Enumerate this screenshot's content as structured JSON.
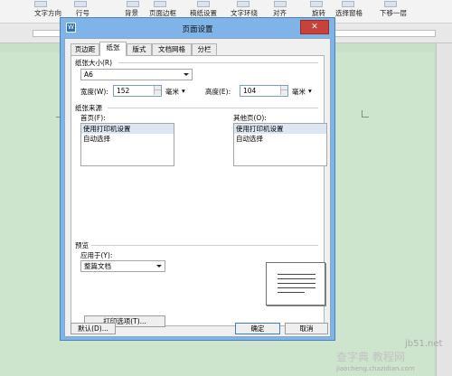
{
  "toolbar": {
    "items": [
      "文字方向",
      "行号",
      "背景",
      "页面边框",
      "稿纸设置",
      "文字环绕",
      "对齐",
      "旋转",
      "选择窗格",
      "下移一层"
    ]
  },
  "dialog": {
    "title": "页面设置",
    "app_icon": "W",
    "close_glyph": "✕",
    "tabs": [
      "页边距",
      "纸张",
      "版式",
      "文档网格",
      "分栏"
    ],
    "active_tab": "纸张",
    "paper_size_label": "纸张大小(R)",
    "paper_size_value": "A6",
    "width_label": "宽度(W):",
    "width_value": "152",
    "width_unit": "毫米",
    "height_label": "高度(E):",
    "height_value": "104",
    "height_unit": "毫米",
    "source_label": "纸张来源",
    "first_page_label": "首页(F):",
    "first_page_options": [
      "使用打印机设置",
      "自动选择"
    ],
    "other_pages_label": "其他页(O):",
    "other_pages_options": [
      "使用打印机设置",
      "自动选择"
    ],
    "preview_label": "预览",
    "apply_to_label": "应用于(Y):",
    "apply_to_value": "整篇文档",
    "print_options_button": "打印选项(T)...",
    "default_button": "默认(D)...",
    "ok_button": "确定",
    "cancel_button": "取消"
  },
  "watermark": {
    "site": "jb51.net",
    "brand": "查字典 教程网",
    "url": "jiaocheng.chazidian.com"
  },
  "colors": {
    "page_background": "#c8e0c8",
    "dialog_frame": "#7eb4e8",
    "close_button": "#c7423a"
  }
}
